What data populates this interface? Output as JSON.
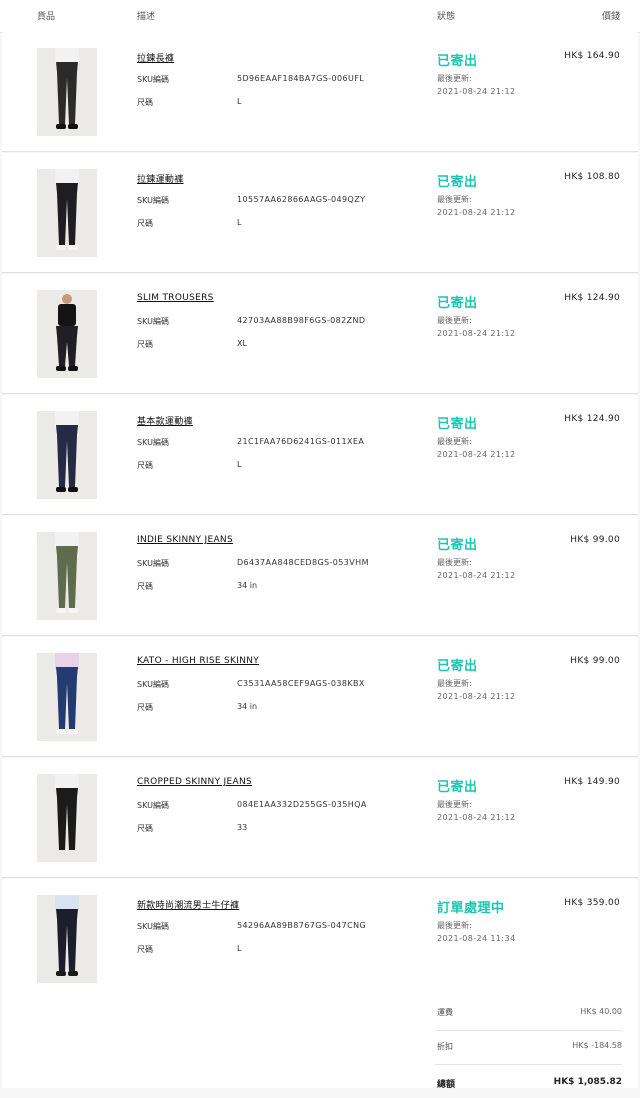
{
  "header": {
    "col_goods": "貨品",
    "col_desc": "描述",
    "col_status": "狀態",
    "col_price": "價錢"
  },
  "labels": {
    "sku": "SKU編碼",
    "size": "尺碼",
    "updated": "最後更新:"
  },
  "colors": {
    "status_accent": "#1cc6b1"
  },
  "items": [
    {
      "name": "拉鍊長褲",
      "sku": "5D96EAAF184BA7GS-006UFL",
      "size": "L",
      "status": "已寄出",
      "updated": "2021-08-24 21:12",
      "price": "HK$ 164.90",
      "image": "product-photo-black-joggers"
    },
    {
      "name": "拉鍊運動褲",
      "sku": "10557AA62866AAGS-049QZY",
      "size": "L",
      "status": "已寄出",
      "updated": "2021-08-24 21:12",
      "price": "HK$ 108.80",
      "image": "product-photo-black-track-pants"
    },
    {
      "name": "SLIM TROUSERS",
      "sku": "42703AA88B98F6GS-082ZND",
      "size": "XL",
      "status": "已寄出",
      "updated": "2021-08-24 21:12",
      "price": "HK$ 124.90",
      "image": "product-photo-black-slim-trousers"
    },
    {
      "name": "基本款運動褲",
      "sku": "21C1FAA76D6241GS-011XEA",
      "size": "L",
      "status": "已寄出",
      "updated": "2021-08-24 21:12",
      "price": "HK$ 124.90",
      "image": "product-photo-navy-joggers"
    },
    {
      "name": "INDIE SKINNY JEANS",
      "sku": "D6437AA848CED8GS-053VHM",
      "size": "34 in",
      "status": "已寄出",
      "updated": "2021-08-24 21:12",
      "price": "HK$ 99.00",
      "image": "product-photo-olive-skinny-jeans"
    },
    {
      "name": "KATO - HIGH RISE SKINNY",
      "sku": "C3531AA58CEF9AGS-038KBX",
      "size": "34 in",
      "status": "已寄出",
      "updated": "2021-08-24 21:12",
      "price": "HK$ 99.00",
      "image": "product-photo-blue-skinny-jeans"
    },
    {
      "name": "CROPPED SKINNY JEANS",
      "sku": "084E1AA332D255GS-035HQA",
      "size": "33",
      "status": "已寄出",
      "updated": "2021-08-24 21:12",
      "price": "HK$ 149.90",
      "image": "product-photo-black-cropped-jeans"
    },
    {
      "name": "新款時尚潮流男士牛仔褲",
      "sku": "54296AA89B8767GS-047CNG",
      "size": "L",
      "status": "訂單處理中",
      "updated": "2021-08-24 11:34",
      "price": "HK$ 359.00",
      "image": "product-photo-black-jeans"
    }
  ],
  "summary": {
    "shipping_label": "運費",
    "shipping_value": "HK$ 40.00",
    "discount_label": "折扣",
    "discount_value": "HK$ -184.58",
    "total_label": "總額",
    "total_value": "HK$ 1,085.82"
  }
}
